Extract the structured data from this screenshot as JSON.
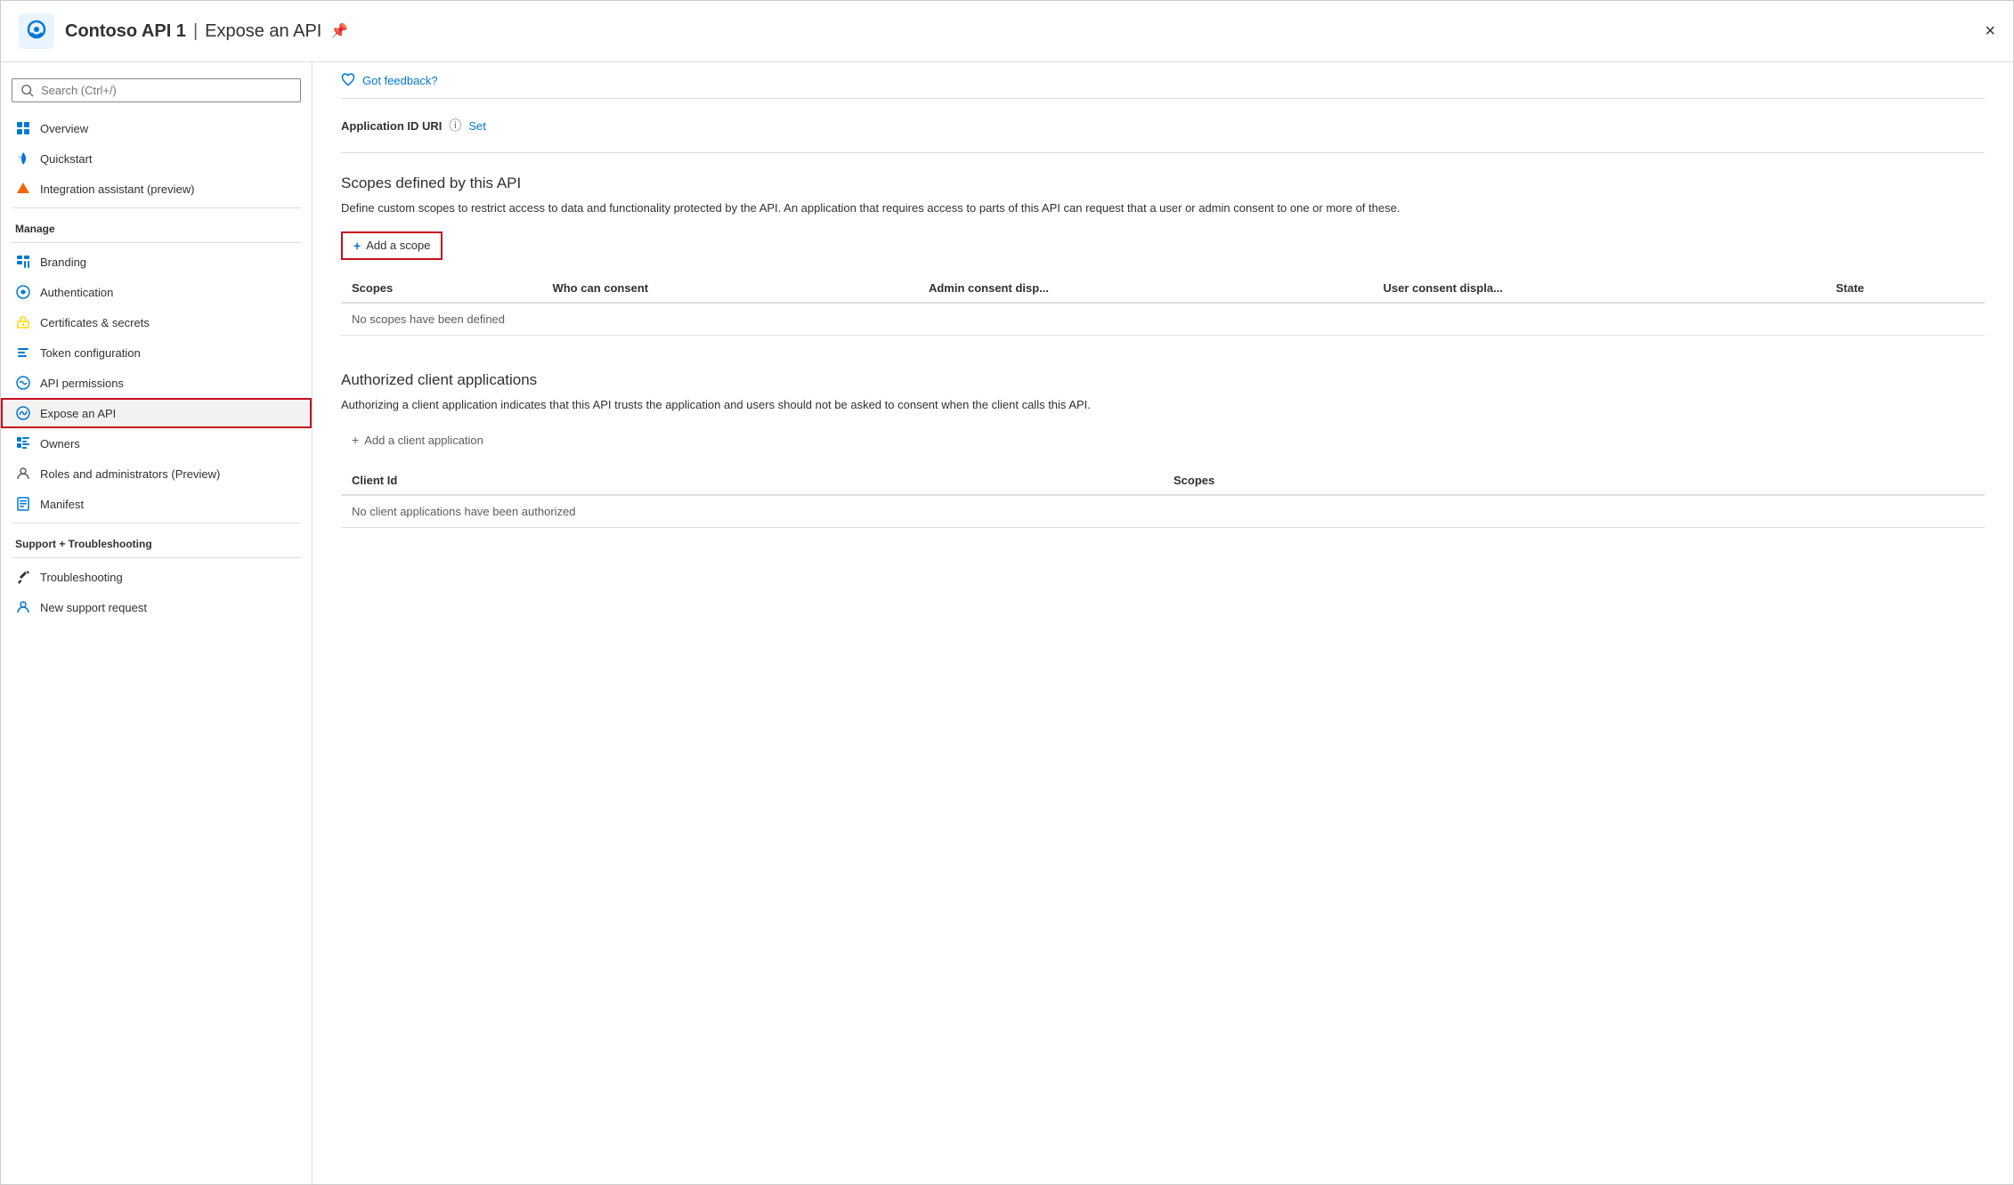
{
  "header": {
    "app_name": "Contoso API 1",
    "separator": "|",
    "page_title": "Expose an API",
    "close_label": "×"
  },
  "sidebar": {
    "search_placeholder": "Search (Ctrl+/)",
    "items": [
      {
        "id": "overview",
        "label": "Overview",
        "icon": "grid-icon"
      },
      {
        "id": "quickstart",
        "label": "Quickstart",
        "icon": "cloud-icon"
      },
      {
        "id": "integration-assistant",
        "label": "Integration assistant (preview)",
        "icon": "rocket-icon"
      }
    ],
    "manage_label": "Manage",
    "manage_items": [
      {
        "id": "branding",
        "label": "Branding",
        "icon": "grid-icon"
      },
      {
        "id": "authentication",
        "label": "Authentication",
        "icon": "sync-icon"
      },
      {
        "id": "certificates",
        "label": "Certificates & secrets",
        "icon": "key-icon"
      },
      {
        "id": "token-configuration",
        "label": "Token configuration",
        "icon": "bars-icon"
      },
      {
        "id": "api-permissions",
        "label": "API permissions",
        "icon": "sync-icon"
      },
      {
        "id": "expose-an-api",
        "label": "Expose an API",
        "icon": "cloud-icon",
        "active": true
      }
    ],
    "manage_items2": [
      {
        "id": "owners",
        "label": "Owners",
        "icon": "grid-icon"
      },
      {
        "id": "roles",
        "label": "Roles and administrators (Preview)",
        "icon": "person-icon"
      },
      {
        "id": "manifest",
        "label": "Manifest",
        "icon": "square-icon"
      }
    ],
    "support_label": "Support + Troubleshooting",
    "support_items": [
      {
        "id": "troubleshooting",
        "label": "Troubleshooting",
        "icon": "wrench-icon"
      },
      {
        "id": "new-support",
        "label": "New support request",
        "icon": "person-icon"
      }
    ]
  },
  "content": {
    "feedback_label": "Got feedback?",
    "app_id_section": {
      "label": "Application ID URI",
      "set_label": "Set"
    },
    "scopes_section": {
      "title": "Scopes defined by this API",
      "description": "Define custom scopes to restrict access to data and functionality protected by the API. An application that requires access to parts of this API can request that a user or admin consent to one or more of these.",
      "add_scope_label": "Add a scope",
      "table": {
        "columns": [
          "Scopes",
          "Who can consent",
          "Admin consent disp...",
          "User consent displa...",
          "State"
        ],
        "empty_message": "No scopes have been defined"
      }
    },
    "authorized_section": {
      "title": "Authorized client applications",
      "description": "Authorizing a client application indicates that this API trusts the application and users should not be asked to consent when the client calls this API.",
      "add_client_label": "Add a client application",
      "table": {
        "columns": [
          "Client Id",
          "Scopes"
        ],
        "empty_message": "No client applications have been authorized"
      }
    }
  }
}
